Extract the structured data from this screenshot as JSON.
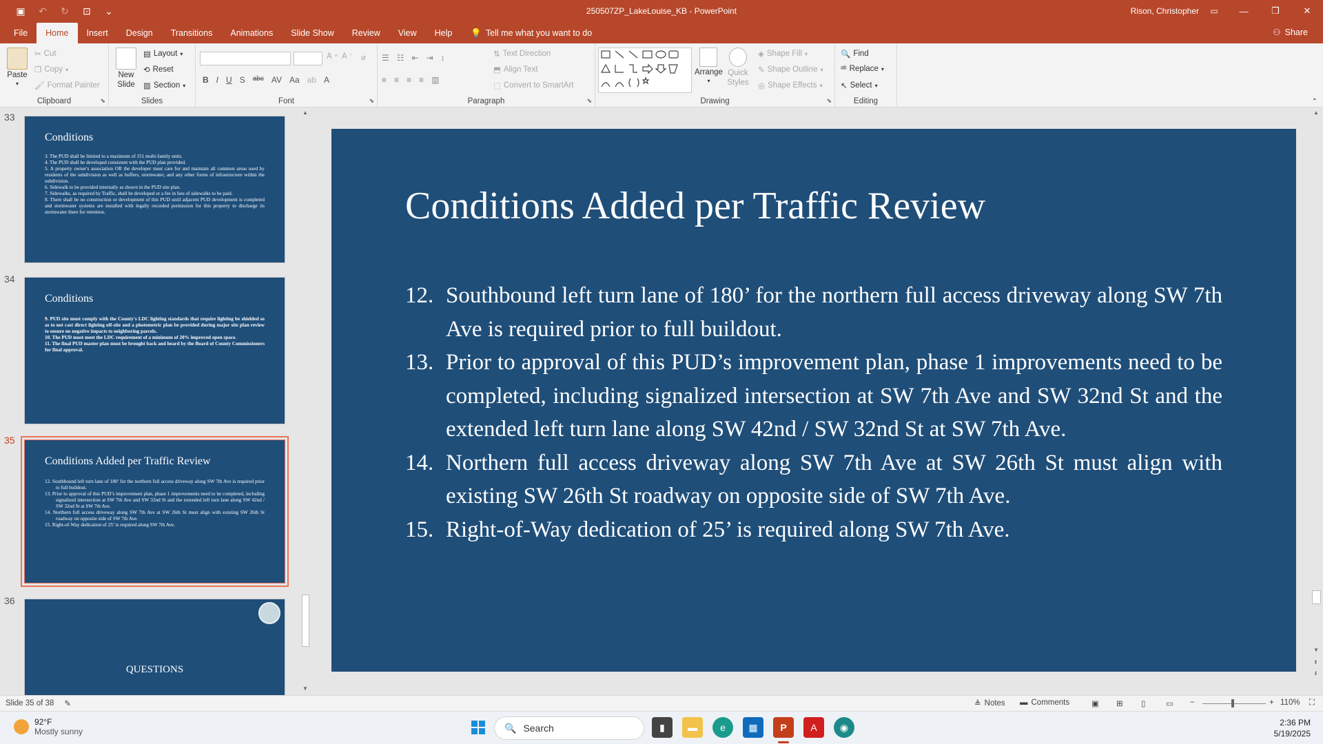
{
  "window": {
    "doc_title": "250507ZP_LakeLouise_KB  -  PowerPoint",
    "user": "Rison, Christopher"
  },
  "tabs": [
    "File",
    "Home",
    "Insert",
    "Design",
    "Transitions",
    "Animations",
    "Slide Show",
    "Review",
    "View",
    "Help"
  ],
  "tell_me": "Tell me what you want to do",
  "share": "Share",
  "ribbon": {
    "clipboard": {
      "label": "Clipboard",
      "paste": "Paste",
      "cut": "Cut",
      "copy": "Copy",
      "format_painter": "Format Painter"
    },
    "slides": {
      "label": "Slides",
      "new_slide": "New Slide",
      "layout": "Layout",
      "reset": "Reset",
      "section": "Section"
    },
    "font": {
      "label": "Font",
      "bold": "B",
      "italic": "I",
      "underline": "U",
      "shadow": "S",
      "strike": "abc"
    },
    "paragraph": {
      "label": "Paragraph",
      "text_direction": "Text Direction",
      "align_text": "Align Text",
      "convert_smartart": "Convert to SmartArt"
    },
    "drawing": {
      "label": "Drawing",
      "arrange": "Arrange",
      "quick_styles": "Quick Styles",
      "shape_fill": "Shape Fill",
      "shape_outline": "Shape Outline",
      "shape_effects": "Shape Effects"
    },
    "editing": {
      "label": "Editing",
      "find": "Find",
      "replace": "Replace",
      "select": "Select"
    }
  },
  "thumbnails": [
    {
      "number": "33",
      "title": "Conditions",
      "lines": [
        "3. The PUD shall be limited to a maximum of 151 multi-family units.",
        "4. The PUD shall be developed consistent with the PUD plan provided.",
        "5. A property owner's association OR the developer must care for and maintain all common areas used by residents of the subdivision as well as buffers, stormwater, and any other forms of infrastructure within the subdivision.",
        "6. Sidewalk to be provided internally as shown in the PUD site plan.",
        "7. Sidewalks, as required by Traffic, shall be developed or a fee in lieu of sidewalks to be paid.",
        "8. There shall be no construction or development of this PUD until adjacent PUD development is completed and stormwater systems are installed with legally recorded permission for this property to discharge its stormwater there for retention."
      ]
    },
    {
      "number": "34",
      "title": "Conditions",
      "lines": [
        "9. PUD site must comply with the County's LDC lighting standards that require lighting be shielded so as to not cast direct lighting off-site and a photometric plan be provided during major site plan review to ensure no negative impacts to neighboring parcels.",
        "10. The PUD must meet the LDC requirement of a minimum of 20% improved open space.",
        "11. The final PUD master plan must be brought back and heard by the Board of County Commissioners for final approval."
      ]
    },
    {
      "number": "35",
      "title": "Conditions Added per Traffic Review",
      "items": [
        {
          "n": "12.",
          "t": " Southbound left turn lane of 180’ for the northern full access driveway along SW 7th Ave is required prior to full buildout."
        },
        {
          "n": "13.",
          "t": "Prior to approval of this PUD’s improvement plan, phase 1 improvements need to be completed, including signalized intersection at SW 7th Ave and SW 32nd St and the extended left turn lane along SW 42nd / SW 32nd St at SW 7th Ave."
        },
        {
          "n": "14.",
          "t": "Northern full access driveway along SW 7th Ave at SW 26th St must align with existing SW 26th St roadway on opposite side of SW 7th Ave."
        },
        {
          "n": "15.",
          "t": "Right-of-Way dedication of 25’ is required along SW 7th Ave."
        }
      ]
    },
    {
      "number": "36",
      "title": "QUESTIONS"
    }
  ],
  "slide": {
    "title": "Conditions Added per Traffic Review",
    "items": [
      {
        "n": "12.",
        "t": " Southbound left turn lane of 180’ for the northern full access driveway along SW 7th Ave is required prior to full buildout."
      },
      {
        "n": "13.",
        "t": "Prior to approval of this PUD’s improvement plan, phase 1 improvements need to be completed, including signalized intersection at SW 7th Ave and SW 32nd St and the extended left turn lane along SW 42nd / SW 32nd St at SW 7th Ave."
      },
      {
        "n": "14.",
        "t": "Northern full access driveway along SW 7th Ave at SW 26th St must align with existing SW 26th St roadway on opposite side of SW 7th Ave."
      },
      {
        "n": "15.",
        "t": "Right-of-Way dedication of 25’ is required along SW 7th Ave."
      }
    ]
  },
  "statusbar": {
    "slide_of": "Slide 35 of 38",
    "notes": "Notes",
    "comments": "Comments",
    "zoom": "110%"
  },
  "taskbar": {
    "temp": "92°F",
    "weather": "Mostly sunny",
    "search": "Search",
    "time": "2:36 PM",
    "date": "5/19/2025"
  },
  "colors": {
    "accent": "#b7472a",
    "slide_bg": "#1f4e79",
    "selection": "#e9735b"
  }
}
